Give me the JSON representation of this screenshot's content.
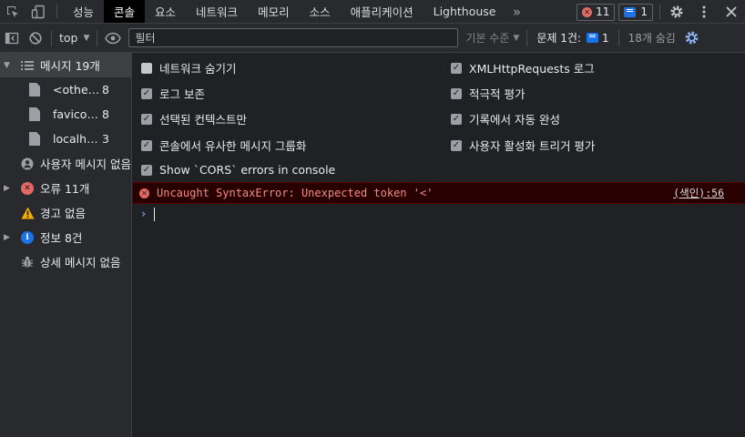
{
  "tabs": [
    "성능",
    "콘솔",
    "요소",
    "네트워크",
    "메모리",
    "소스",
    "애플리케이션",
    "Lighthouse"
  ],
  "active_tab": 1,
  "error_badge_count": "11",
  "message_badge_count": "1",
  "toolbar": {
    "context": "top",
    "filter_placeholder": "필터",
    "levels": "기본 수준",
    "issues_label": "문제 1건:",
    "issues_count": "1",
    "hidden_count": "18개 숨김"
  },
  "sidebar": {
    "items": [
      {
        "label": "메시지 19개",
        "count": "",
        "icon": "list-icon"
      },
      {
        "label": "<other>",
        "count": "8",
        "icon": "file-icon"
      },
      {
        "label": "favicon.ico",
        "count": "8",
        "icon": "file-icon"
      },
      {
        "label": "localhost",
        "count": "3",
        "icon": "file-icon"
      },
      {
        "label": "사용자 메시지 없음",
        "count": "",
        "icon": "user-icon"
      },
      {
        "label": "오류 11개",
        "count": "",
        "icon": "error-icon"
      },
      {
        "label": "경고 없음",
        "count": "",
        "icon": "warning-icon"
      },
      {
        "label": "정보 8건",
        "count": "",
        "icon": "info-icon"
      },
      {
        "label": "상세 메시지 없음",
        "count": "",
        "icon": "bug-icon"
      }
    ]
  },
  "settings": {
    "left": [
      {
        "label": "네트워크 숨기기",
        "checked": false
      },
      {
        "label": "로그 보존",
        "checked": true
      },
      {
        "label": "선택된 컨텍스트만",
        "checked": true
      },
      {
        "label": "콘솔에서 유사한 메시지 그룹화",
        "checked": true
      },
      {
        "label": "Show `CORS` errors in console",
        "checked": true
      }
    ],
    "right": [
      {
        "label": "XMLHttpRequests 로그",
        "checked": true
      },
      {
        "label": "적극적 평가",
        "checked": true
      },
      {
        "label": "기록에서 자동 완성",
        "checked": true
      },
      {
        "label": "사용자 활성화 트리거 평가",
        "checked": true
      }
    ]
  },
  "console": {
    "error_message": "Uncaught SyntaxError: Unexpected token '<'",
    "error_source": "(색인):56"
  },
  "colors": {
    "error": "#e46962",
    "warning": "#f9ab00",
    "info": "#1a73e8",
    "accent": "#8ab4f8"
  }
}
